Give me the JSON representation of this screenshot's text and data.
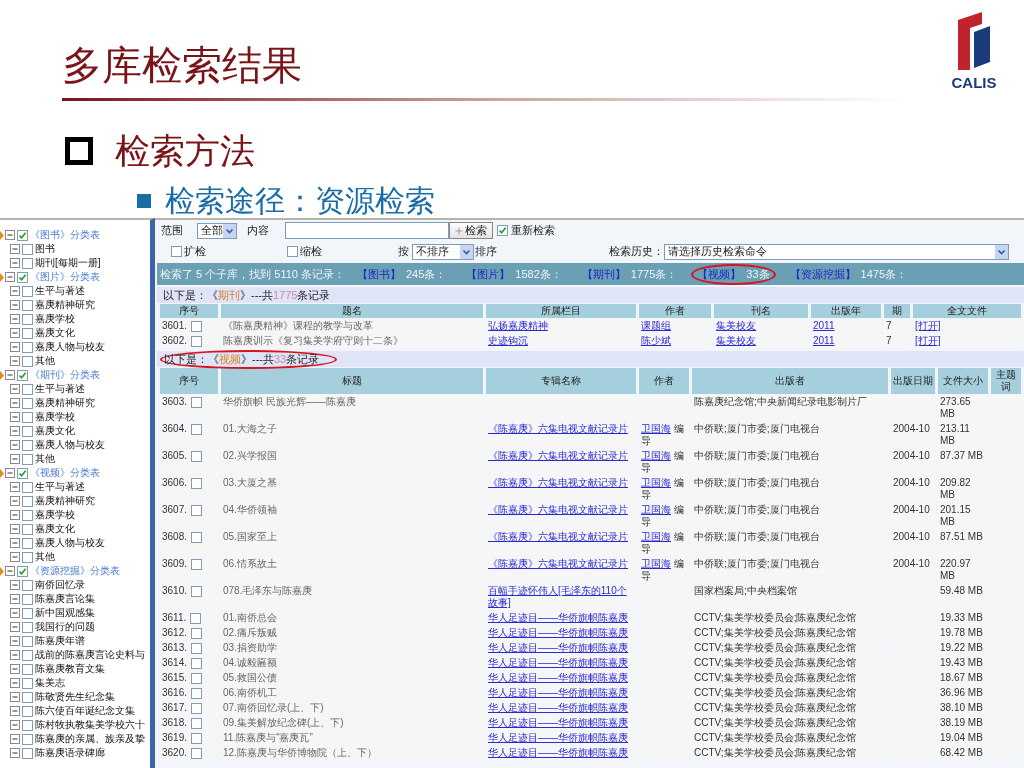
{
  "slide": {
    "title": "多库检索结果",
    "bullet": "检索方法",
    "sub_bullet": "检索途径：资源检索",
    "logo_text": "CALIS"
  },
  "sidebar": {
    "groups": [
      {
        "label": "《图书》分类表",
        "checked": true,
        "children": [
          {
            "label": "图书",
            "checked": false
          },
          {
            "label": "期刊[每期一册]",
            "checked": false
          }
        ]
      },
      {
        "label": "《图片》分类表",
        "checked": true,
        "children": [
          {
            "label": "生平与著述",
            "checked": false
          },
          {
            "label": "嘉庚精神研究",
            "checked": false
          },
          {
            "label": "嘉庚学校",
            "checked": false
          },
          {
            "label": "嘉庚文化",
            "checked": false
          },
          {
            "label": "嘉庚人物与校友",
            "checked": false
          },
          {
            "label": "其他",
            "checked": false
          }
        ]
      },
      {
        "label": "《期刊》分类表",
        "checked": true,
        "children": [
          {
            "label": "生平与著述",
            "checked": false
          },
          {
            "label": "嘉庚精神研究",
            "checked": false
          },
          {
            "label": "嘉庚学校",
            "checked": false
          },
          {
            "label": "嘉庚文化",
            "checked": false
          },
          {
            "label": "嘉庚人物与校友",
            "checked": false
          },
          {
            "label": "其他",
            "checked": false
          }
        ]
      },
      {
        "label": "《视频》分类表",
        "checked": true,
        "children": [
          {
            "label": "生平与著述",
            "checked": false
          },
          {
            "label": "嘉庚精神研究",
            "checked": false
          },
          {
            "label": "嘉庚学校",
            "checked": false
          },
          {
            "label": "嘉庚文化",
            "checked": false
          },
          {
            "label": "嘉庚人物与校友",
            "checked": false
          },
          {
            "label": "其他",
            "checked": false
          }
        ]
      },
      {
        "label": "《资源挖掘》分类表",
        "checked": true,
        "children": [
          {
            "label": "南侨回忆录",
            "checked": false
          },
          {
            "label": "陈嘉庚言论集",
            "checked": false
          },
          {
            "label": "新中国观感集",
            "checked": false
          },
          {
            "label": "我国行的问题",
            "checked": false
          },
          {
            "label": "陈嘉庚年谱",
            "checked": false
          },
          {
            "label": "战前的陈嘉庚言论史料与",
            "checked": false
          },
          {
            "label": "陈嘉庚教育文集",
            "checked": false
          },
          {
            "label": "集美志",
            "checked": false
          },
          {
            "label": "陈敬贤先生纪念集",
            "checked": false
          },
          {
            "label": "陈六使百年诞纪念文集",
            "checked": false
          },
          {
            "label": "陈村牧执教集美学校六十",
            "checked": false
          },
          {
            "label": "陈嘉庚的亲属、族亲及挚",
            "checked": false
          },
          {
            "label": "陈嘉庚语录碑廊",
            "checked": false
          }
        ]
      }
    ]
  },
  "search": {
    "scope_label": "范围",
    "scope_value": "全部",
    "content_label": "内容",
    "search_button": "检索",
    "renew": {
      "label": "重新检索",
      "checked": true
    },
    "expand": {
      "label": "扩检",
      "checked": false
    },
    "narrow": {
      "label": "缩检",
      "checked": false
    },
    "sort_prefix": "按",
    "sort_value": "不排序",
    "sort_suffix": "排序",
    "history_label": "检索历史：",
    "history_value": "请选择历史检索命令"
  },
  "summary": {
    "text": "检索了 5 个子库，找到 5110 条记录：",
    "databases": [
      {
        "name": "【图书】",
        "count": "245条：",
        "highlighted": false
      },
      {
        "name": "【图片】",
        "count": "1582条：",
        "highlighted": false
      },
      {
        "name": "【期刊】",
        "count": "1775条：",
        "highlighted": false
      },
      {
        "name": "【视频】",
        "count": "33条",
        "highlighted": true
      },
      {
        "name": "【资源挖掘】",
        "count": "1475条：",
        "highlighted": false
      }
    ]
  },
  "sections": [
    {
      "caption": {
        "prefix": "以下是：《",
        "db": "期刊",
        "middle": "》---共",
        "count": "1775",
        "suffix": "条记录",
        "highlighted": false
      },
      "columns": [
        "序号",
        "题名",
        "所属栏目",
        "作者",
        "刊名",
        "出版年",
        "期",
        "全文文件"
      ],
      "rows": [
        {
          "cells": [
            {
              "kind": "number",
              "text": "3601.",
              "checked": false
            },
            {
              "kind": "text",
              "text": "《陈嘉庚精神》课程的教学与改革"
            },
            {
              "kind": "link",
              "text": "弘扬嘉庚精神"
            },
            {
              "kind": "link",
              "text": "课题组"
            },
            {
              "kind": "link",
              "text": "集美校友"
            },
            {
              "kind": "link",
              "text": "2011"
            },
            {
              "kind": "text",
              "text": "7"
            },
            {
              "kind": "link",
              "text": "[打开]"
            }
          ]
        },
        {
          "cells": [
            {
              "kind": "number",
              "text": "3602.",
              "checked": false
            },
            {
              "kind": "text",
              "text": "陈嘉庚训示《复习集美学府守则十二条》"
            },
            {
              "kind": "link",
              "text": "史迹钩沉"
            },
            {
              "kind": "link",
              "text": "陈少斌"
            },
            {
              "kind": "link",
              "text": "集美校友"
            },
            {
              "kind": "link",
              "text": "2011"
            },
            {
              "kind": "text",
              "text": "7"
            },
            {
              "kind": "link",
              "text": "[打开]"
            }
          ]
        }
      ]
    },
    {
      "caption": {
        "prefix": "以下是：《",
        "db": "视频",
        "middle": "》---共",
        "count": "33",
        "suffix": "条记录",
        "highlighted": true
      },
      "columns": [
        "序号",
        "标题",
        "专辑名称",
        "作者",
        "出版者",
        "出版日期",
        "文件大小",
        "主题词"
      ],
      "rows": [
        {
          "cells": [
            {
              "kind": "number",
              "text": "3603.",
              "checked": false
            },
            {
              "kind": "text",
              "text": "华侨旗帜 民族光辉——陈嘉庚"
            },
            null,
            null,
            {
              "kind": "text",
              "text": "陈嘉庚纪念馆;中央新闻纪录电影制片厂"
            },
            null,
            {
              "kind": "text",
              "text": "273.65 MB"
            },
            null
          ]
        },
        {
          "cells": [
            {
              "kind": "number",
              "text": "3604.",
              "checked": false
            },
            {
              "kind": "text",
              "text": "01.大海之子"
            },
            {
              "kind": "link",
              "text": "《陈嘉庚》六集电视文献记录片"
            },
            {
              "kind": "credit",
              "link": "卫国海",
              "text": "编导"
            },
            {
              "kind": "text",
              "text": "中侨联;厦门市委;厦门电视台"
            },
            {
              "kind": "text",
              "text": "2004-10"
            },
            {
              "kind": "text",
              "text": "213.11 MB"
            },
            null
          ]
        },
        {
          "cells": [
            {
              "kind": "number",
              "text": "3605.",
              "checked": false
            },
            {
              "kind": "text",
              "text": "02.兴学报国"
            },
            {
              "kind": "link",
              "text": "《陈嘉庚》六集电视文献记录片"
            },
            {
              "kind": "credit",
              "link": "卫国海",
              "text": "编导"
            },
            {
              "kind": "text",
              "text": "中侨联;厦门市委;厦门电视台"
            },
            {
              "kind": "text",
              "text": "2004-10"
            },
            {
              "kind": "text",
              "text": "87.37 MB"
            },
            null
          ]
        },
        {
          "cells": [
            {
              "kind": "number",
              "text": "3606.",
              "checked": false
            },
            {
              "kind": "text",
              "text": "03.大厦之基"
            },
            {
              "kind": "link",
              "text": "《陈嘉庚》六集电视文献记录片"
            },
            {
              "kind": "credit",
              "link": "卫国海",
              "text": "编导"
            },
            {
              "kind": "text",
              "text": "中侨联;厦门市委;厦门电视台"
            },
            {
              "kind": "text",
              "text": "2004-10"
            },
            {
              "kind": "text",
              "text": "209.82 MB"
            },
            null
          ]
        },
        {
          "cells": [
            {
              "kind": "number",
              "text": "3607.",
              "checked": false
            },
            {
              "kind": "text",
              "text": "04.华侨领袖"
            },
            {
              "kind": "link",
              "text": "《陈嘉庚》六集电视文献记录片"
            },
            {
              "kind": "credit",
              "link": "卫国海",
              "text": "编导"
            },
            {
              "kind": "text",
              "text": "中侨联;厦门市委;厦门电视台"
            },
            {
              "kind": "text",
              "text": "2004-10"
            },
            {
              "kind": "text",
              "text": "201.15 MB"
            },
            null
          ]
        },
        {
          "cells": [
            {
              "kind": "number",
              "text": "3608.",
              "checked": false
            },
            {
              "kind": "text",
              "text": "05.国家至上"
            },
            {
              "kind": "link",
              "text": "《陈嘉庚》六集电视文献记录片"
            },
            {
              "kind": "credit",
              "link": "卫国海",
              "text": "编导"
            },
            {
              "kind": "text",
              "text": "中侨联;厦门市委;厦门电视台"
            },
            {
              "kind": "text",
              "text": "2004-10"
            },
            {
              "kind": "text",
              "text": "87.51 MB"
            },
            null
          ]
        },
        {
          "cells": [
            {
              "kind": "number",
              "text": "3609.",
              "checked": false
            },
            {
              "kind": "text",
              "text": "06.情系故土"
            },
            {
              "kind": "link",
              "text": "《陈嘉庚》六集电视文献记录片"
            },
            {
              "kind": "credit",
              "link": "卫国海",
              "text": "编导"
            },
            {
              "kind": "text",
              "text": "中侨联;厦门市委;厦门电视台"
            },
            {
              "kind": "text",
              "text": "2004-10"
            },
            {
              "kind": "text",
              "text": "220.97 MB"
            },
            null
          ]
        },
        {
          "cells": [
            {
              "kind": "number",
              "text": "3610.",
              "checked": false
            },
            {
              "kind": "text",
              "text": "078.毛泽东与陈嘉庚"
            },
            {
              "kind": "link",
              "text": "百幅手迹怀伟人[毛泽东的110个故事]"
            },
            null,
            {
              "kind": "text",
              "text": "国家档案局;中央档案馆"
            },
            null,
            {
              "kind": "text",
              "text": "59.48 MB"
            },
            null
          ]
        },
        {
          "cells": [
            {
              "kind": "number",
              "text": "3611.",
              "checked": false
            },
            {
              "kind": "text",
              "text": "01.南侨总会"
            },
            {
              "kind": "link",
              "text": "华人足迹目——华侨旗帜陈嘉庚"
            },
            null,
            {
              "kind": "text",
              "text": "CCTV;集美学校委员会;陈嘉庚纪念馆"
            },
            null,
            {
              "kind": "text",
              "text": "19.33 MB"
            },
            null
          ]
        },
        {
          "cells": [
            {
              "kind": "number",
              "text": "3612.",
              "checked": false
            },
            {
              "kind": "text",
              "text": "02.痛斥叛贼"
            },
            {
              "kind": "link",
              "text": "华人足迹目——华侨旗帜陈嘉庚"
            },
            null,
            {
              "kind": "text",
              "text": "CCTV;集美学校委员会;陈嘉庚纪念馆"
            },
            null,
            {
              "kind": "text",
              "text": "19.78 MB"
            },
            null
          ]
        },
        {
          "cells": [
            {
              "kind": "number",
              "text": "3613.",
              "checked": false
            },
            {
              "kind": "text",
              "text": "03.捐资助学"
            },
            {
              "kind": "link",
              "text": "华人足迹目——华侨旗帜陈嘉庚"
            },
            null,
            {
              "kind": "text",
              "text": "CCTV;集美学校委员会;陈嘉庚纪念馆"
            },
            null,
            {
              "kind": "text",
              "text": "19.22 MB"
            },
            null
          ]
        },
        {
          "cells": [
            {
              "kind": "number",
              "text": "3614.",
              "checked": false
            },
            {
              "kind": "text",
              "text": "04.诚毅匾额"
            },
            {
              "kind": "link",
              "text": "华人足迹目——华侨旗帜陈嘉庚"
            },
            null,
            {
              "kind": "text",
              "text": "CCTV;集美学校委员会;陈嘉庚纪念馆"
            },
            null,
            {
              "kind": "text",
              "text": "19.43 MB"
            },
            null
          ]
        },
        {
          "cells": [
            {
              "kind": "number",
              "text": "3615.",
              "checked": false
            },
            {
              "kind": "text",
              "text": "05.救国公债"
            },
            {
              "kind": "link",
              "text": "华人足迹目——华侨旗帜陈嘉庚"
            },
            null,
            {
              "kind": "text",
              "text": "CCTV;集美学校委员会;陈嘉庚纪念馆"
            },
            null,
            {
              "kind": "text",
              "text": "18.67 MB"
            },
            null
          ]
        },
        {
          "cells": [
            {
              "kind": "number",
              "text": "3616.",
              "checked": false
            },
            {
              "kind": "text",
              "text": "06.南侨机工"
            },
            {
              "kind": "link",
              "text": "华人足迹目——华侨旗帜陈嘉庚"
            },
            null,
            {
              "kind": "text",
              "text": "CCTV;集美学校委员会;陈嘉庚纪念馆"
            },
            null,
            {
              "kind": "text",
              "text": "36.96 MB"
            },
            null
          ]
        },
        {
          "cells": [
            {
              "kind": "number",
              "text": "3617.",
              "checked": false
            },
            {
              "kind": "text",
              "text": "07.南侨回忆录(上、下)"
            },
            {
              "kind": "link",
              "text": "华人足迹目——华侨旗帜陈嘉庚"
            },
            null,
            {
              "kind": "text",
              "text": "CCTV;集美学校委员会;陈嘉庚纪念馆"
            },
            null,
            {
              "kind": "text",
              "text": "38.10 MB"
            },
            null
          ]
        },
        {
          "cells": [
            {
              "kind": "number",
              "text": "3618.",
              "checked": false
            },
            {
              "kind": "text",
              "text": "09.集美解放纪念碑(上、下)"
            },
            {
              "kind": "link",
              "text": "华人足迹目——华侨旗帜陈嘉庚"
            },
            null,
            {
              "kind": "text",
              "text": "CCTV;集美学校委员会;陈嘉庚纪念馆"
            },
            null,
            {
              "kind": "text",
              "text": "38.19 MB"
            },
            null
          ]
        },
        {
          "cells": [
            {
              "kind": "number",
              "text": "3619.",
              "checked": false
            },
            {
              "kind": "text",
              "text": "11.陈嘉庚与“嘉庚瓦”"
            },
            {
              "kind": "link",
              "text": "华人足迹目——华侨旗帜陈嘉庚"
            },
            null,
            {
              "kind": "text",
              "text": "CCTV;集美学校委员会;陈嘉庚纪念馆"
            },
            null,
            {
              "kind": "text",
              "text": "19.04 MB"
            },
            null
          ]
        },
        {
          "cells": [
            {
              "kind": "number",
              "text": "3620.",
              "checked": false
            },
            {
              "kind": "text",
              "text": "12.陈嘉庚与华侨博物院（上、下）"
            },
            {
              "kind": "link",
              "text": "华人足迹目——华侨旗帜陈嘉庚"
            },
            null,
            {
              "kind": "text",
              "text": "CCTV;集美学校委员会;陈嘉庚纪念馆"
            },
            null,
            {
              "kind": "text",
              "text": "68.42 MB"
            },
            null
          ]
        }
      ]
    }
  ]
}
